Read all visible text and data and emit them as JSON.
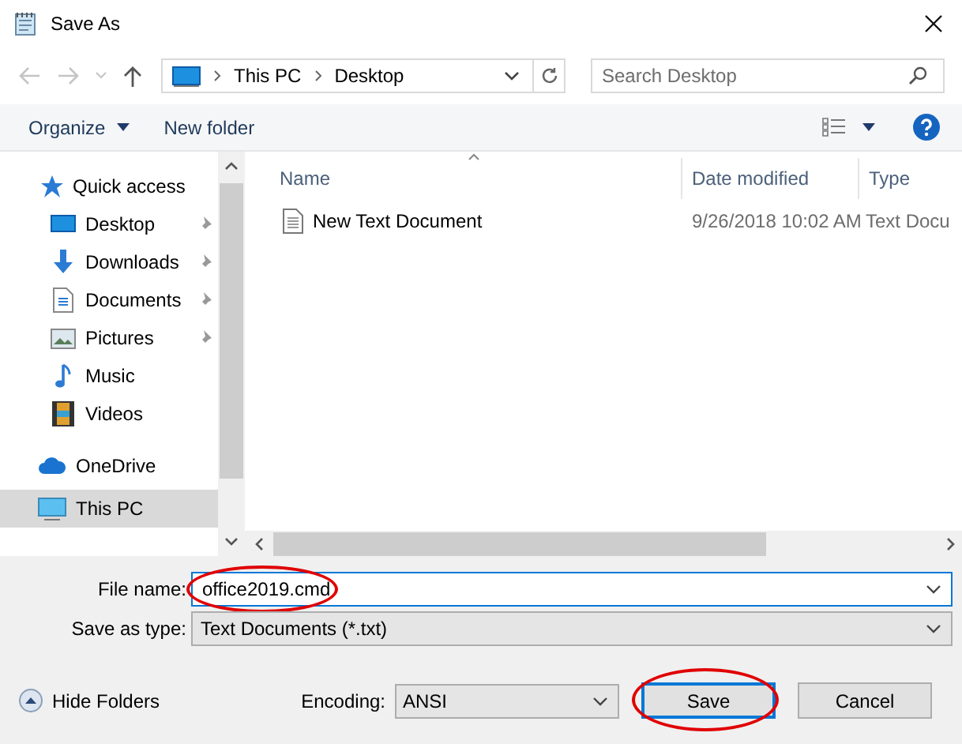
{
  "window": {
    "title": "Save As"
  },
  "address_bar": {
    "crumbs": [
      "This PC",
      "Desktop"
    ]
  },
  "search": {
    "placeholder": "Search Desktop"
  },
  "toolbar": {
    "organize": "Organize",
    "new_folder": "New folder"
  },
  "nav": {
    "items": [
      {
        "label": "Quick access",
        "kind": "group",
        "pinned": false,
        "selected": false
      },
      {
        "label": "Desktop",
        "kind": "item",
        "pinned": true,
        "selected": false
      },
      {
        "label": "Downloads",
        "kind": "item",
        "pinned": true,
        "selected": false
      },
      {
        "label": "Documents",
        "kind": "item",
        "pinned": true,
        "selected": false
      },
      {
        "label": "Pictures",
        "kind": "item",
        "pinned": true,
        "selected": false
      },
      {
        "label": "Music",
        "kind": "item",
        "pinned": false,
        "selected": false
      },
      {
        "label": "Videos",
        "kind": "item",
        "pinned": false,
        "selected": false
      },
      {
        "label": "OneDrive",
        "kind": "group",
        "pinned": false,
        "selected": false
      },
      {
        "label": "This PC",
        "kind": "group",
        "pinned": false,
        "selected": true
      }
    ]
  },
  "file_list": {
    "columns": [
      "Name",
      "Date modified",
      "Type"
    ],
    "rows": [
      {
        "name": "New Text Document",
        "date": "9/26/2018 10:02 AM",
        "type": "Text Docu",
        "selected": false
      }
    ]
  },
  "form": {
    "file_name_label": "File name:",
    "file_name": "office2019.cmd",
    "file_name_circled": true,
    "type_label": "Save as type:",
    "type": "Text Documents (*.txt)",
    "hide_folders": "Hide Folders",
    "encoding_label": "Encoding:",
    "encoding": "ANSI"
  },
  "buttons": [
    {
      "label": "Save",
      "default": true,
      "circled": true
    },
    {
      "label": "Cancel",
      "default": false,
      "circled": false
    }
  ]
}
